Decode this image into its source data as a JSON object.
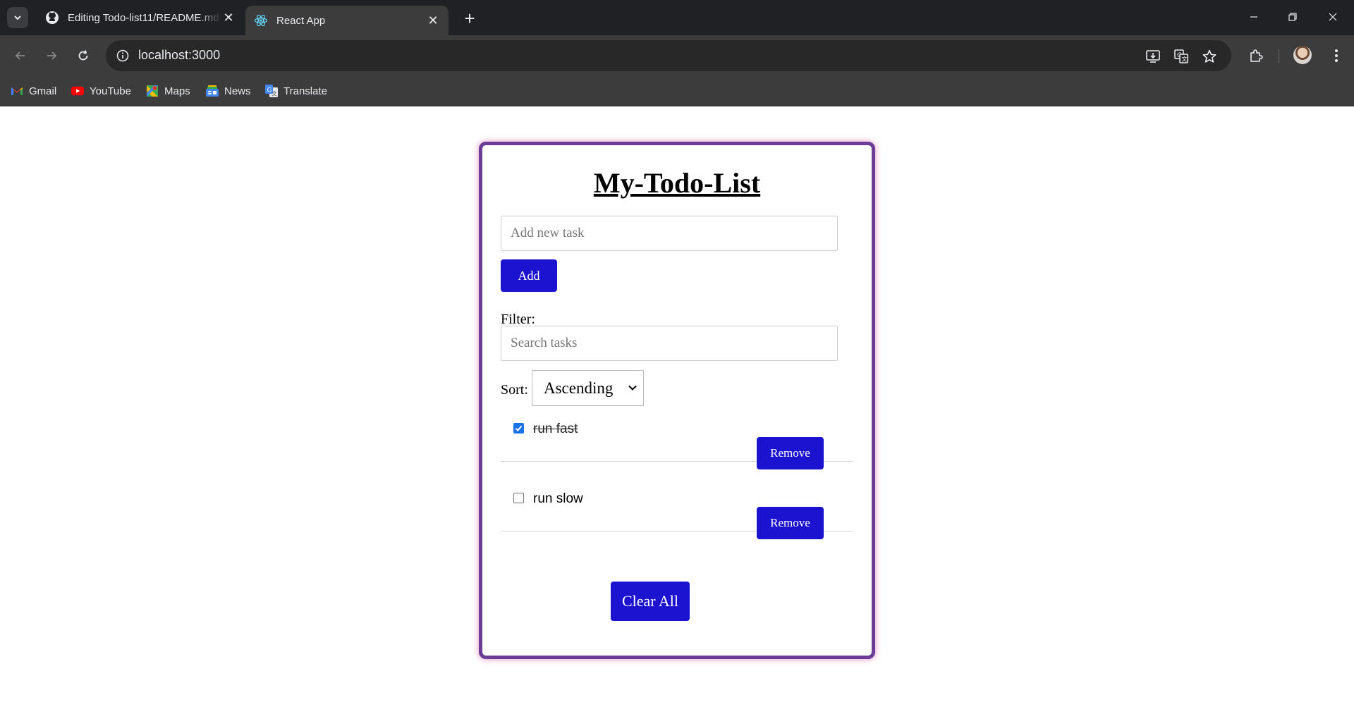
{
  "browser": {
    "tabs": [
      {
        "title": "Editing Todo-list11/README.md",
        "active": false,
        "favicon": "github-icon"
      },
      {
        "title": "React App",
        "active": true,
        "favicon": "react-icon"
      }
    ],
    "address": "localhost:3000",
    "bookmarks": [
      {
        "label": "Gmail",
        "icon": "gmail-icon"
      },
      {
        "label": "YouTube",
        "icon": "youtube-icon"
      },
      {
        "label": "Maps",
        "icon": "maps-icon"
      },
      {
        "label": "News",
        "icon": "news-icon"
      },
      {
        "label": "Translate",
        "icon": "translate-icon"
      }
    ],
    "accent": "#3c3c3c"
  },
  "app": {
    "title": "My-Todo-List",
    "task_input": {
      "placeholder": "Add new task",
      "value": ""
    },
    "add_label": "Add",
    "filter_label": "Filter:",
    "search_input": {
      "placeholder": "Search tasks",
      "value": ""
    },
    "sort_label": "Sort:",
    "sort_selected": "Ascending",
    "todos": [
      {
        "text": "run fast",
        "completed": true,
        "remove_label": "Remove"
      },
      {
        "text": "run slow",
        "completed": false,
        "remove_label": "Remove"
      }
    ],
    "clear_label": "Clear All",
    "colors": {
      "button": "#1c13d0",
      "border": "#6a3d96",
      "glow": "#d65caa"
    }
  }
}
